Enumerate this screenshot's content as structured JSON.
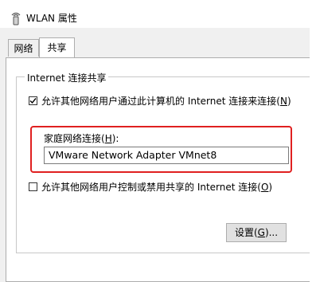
{
  "window": {
    "title": "WLAN 属性"
  },
  "tabs": [
    {
      "label": "网络"
    },
    {
      "label": "共享"
    }
  ],
  "group": {
    "legend": "Internet 连接共享"
  },
  "allow_sharing": {
    "checked": true,
    "label_main": "允许其他网络用户通过此计算机的 Internet 连接来连接(",
    "label_key": "N",
    "label_end": ")"
  },
  "home_network": {
    "label_main": "家庭网络连接(",
    "label_key": "H",
    "label_end": "):",
    "value": "VMware Network Adapter VMnet8"
  },
  "allow_control": {
    "checked": false,
    "label_main": "允许其他网络用户控制或禁用共享的 Internet 连接(",
    "label_key": "O",
    "label_end": ")"
  },
  "settings_button": {
    "label_main": "设置(",
    "label_key": "G",
    "label_end": ")..."
  },
  "colors": {
    "highlight": "#e02020"
  }
}
